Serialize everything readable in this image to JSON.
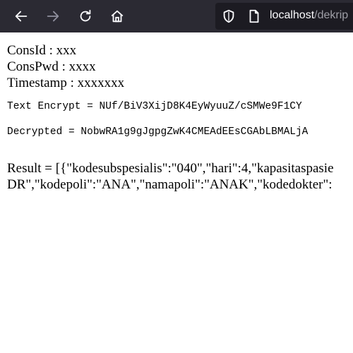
{
  "browser": {
    "url_host": "localhost",
    "url_path": "/dekrip"
  },
  "page": {
    "cons_id": "ConsId : xxx",
    "cons_pwd": "ConsPwd : xxxx",
    "timestamp": "Timestamp : xxxxxxx",
    "text_encrypt": "Text Encrypt  = NUf/BiV3XijD8K4EyWyuuZ/cSMWe9F1CY",
    "decrypted": "Decrypted = NobwRA1g9gJgpgZwK4CMEAdEEsCGAbLBMALjA",
    "result_line1": "Result = [{\"kodesubspesialis\":\"040\",\"hari\":4,\"kapasitaspasie",
    "result_line2": "DR\",\"kodepoli\":\"ANA\",\"namapoli\":\"ANAK\",\"kodedokter\":"
  }
}
